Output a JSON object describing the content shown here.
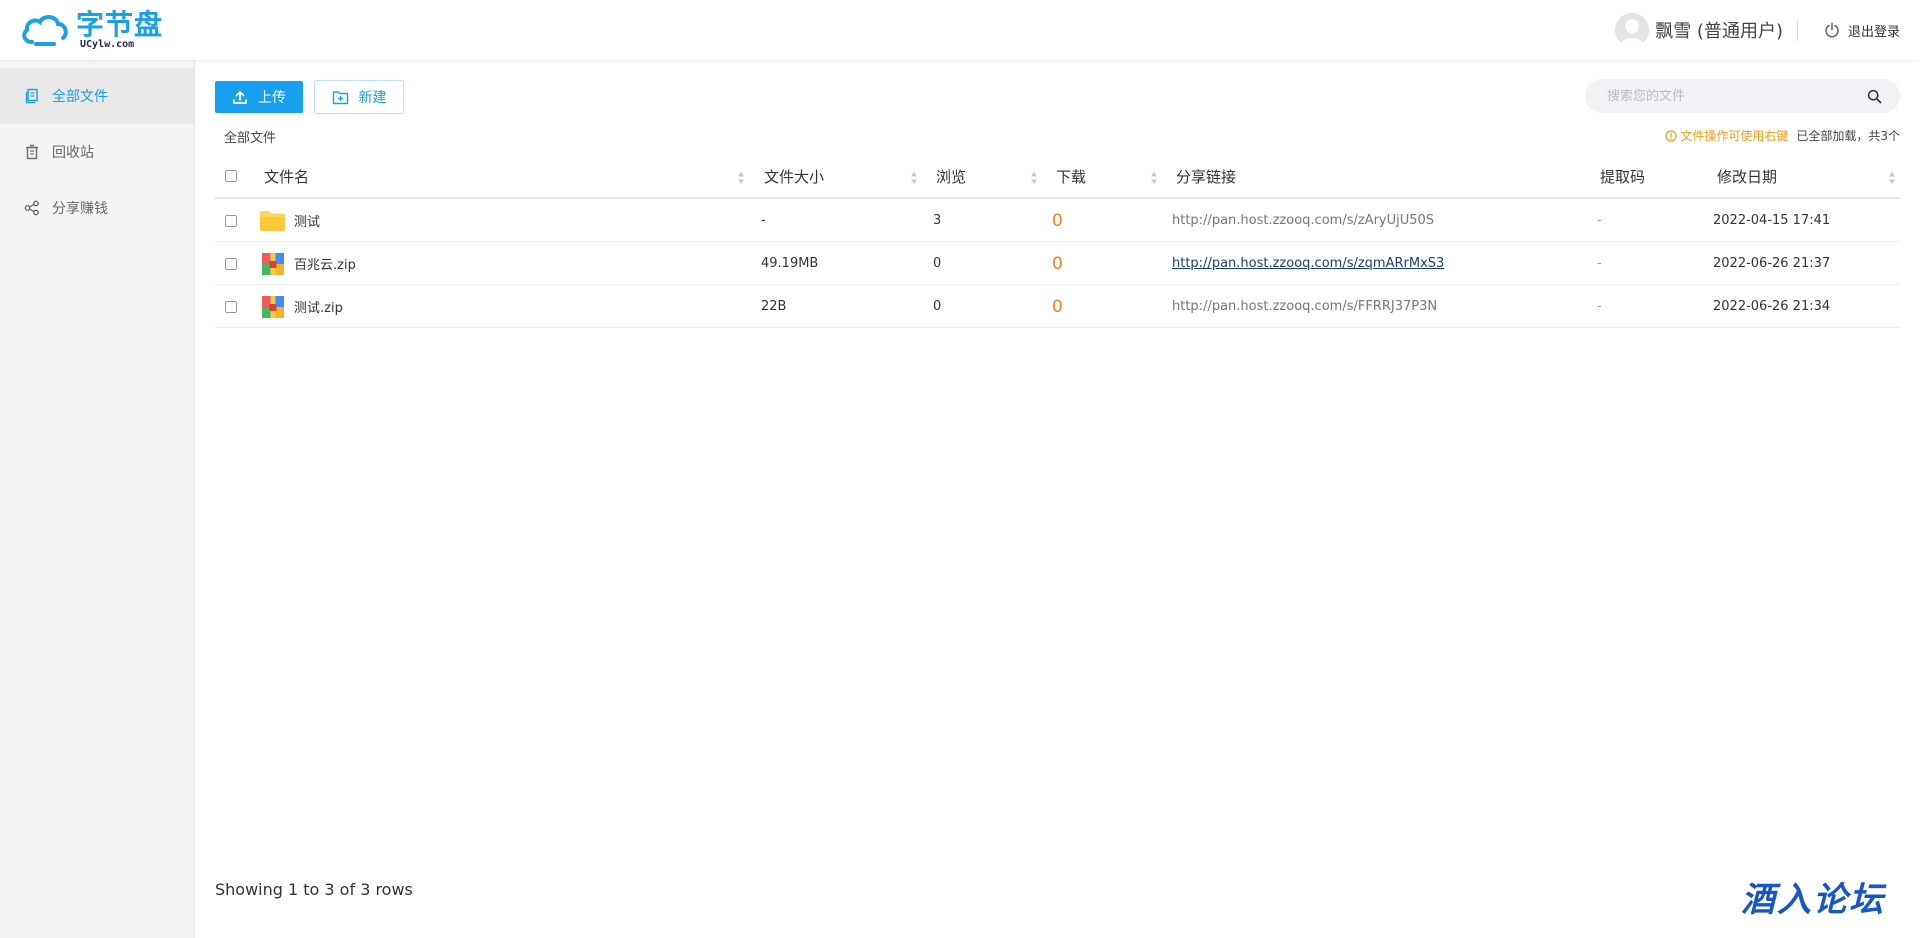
{
  "header": {
    "logo_main": "字节盘",
    "logo_sub": "UCylw.com",
    "username": "飘雪 (普通用户)",
    "logout_label": "退出登录"
  },
  "sidebar": {
    "items": [
      {
        "label": "全部文件",
        "icon": "files-icon",
        "active": true
      },
      {
        "label": "回收站",
        "icon": "trash-icon",
        "active": false
      },
      {
        "label": "分享赚钱",
        "icon": "share-icon",
        "active": false
      }
    ]
  },
  "toolbar": {
    "upload_label": "上传",
    "new_label": "新建",
    "search_placeholder": "搜索您的文件"
  },
  "breadcrumb": "全部文件",
  "tip": "文件操作可使用右键",
  "loaded_text": "已全部加载，共3个",
  "table": {
    "headers": [
      "文件名",
      "文件大小",
      "浏览",
      "下载",
      "分享链接",
      "提取码",
      "修改日期"
    ],
    "rows": [
      {
        "type": "folder",
        "name": "测试",
        "size": "-",
        "views": "3",
        "downloads": "0",
        "link": "http://pan.host.zzooq.com/s/zAryUjU50S",
        "link_hover": false,
        "code": "-",
        "date": "2022-04-15 17:41"
      },
      {
        "type": "zip",
        "name": "百兆云.zip",
        "size": "49.19MB",
        "views": "0",
        "downloads": "0",
        "link": "http://pan.host.zzooq.com/s/zqmARrMxS3",
        "link_hover": true,
        "code": "-",
        "date": "2022-06-26 21:37"
      },
      {
        "type": "zip",
        "name": "测试.zip",
        "size": "22B",
        "views": "0",
        "downloads": "0",
        "link": "http://pan.host.zzooq.com/s/FFRRJ37P3N",
        "link_hover": false,
        "code": "-",
        "date": "2022-06-26 21:34"
      }
    ]
  },
  "footer": {
    "pagination_text": "Showing 1 to 3 of 3 rows",
    "watermark": "酒入论坛"
  },
  "colors": {
    "accent": "#18a0f0",
    "warning": "#f39c12",
    "download": "#f08020",
    "watermark": "#1656c8"
  }
}
